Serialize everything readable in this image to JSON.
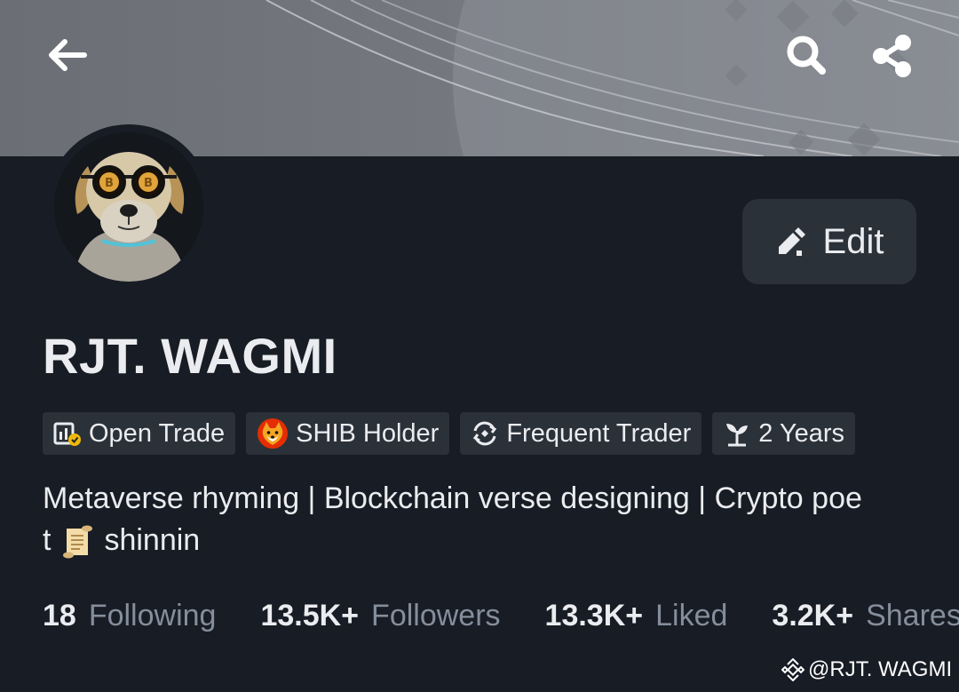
{
  "profile": {
    "name": "RJT. WAGMI",
    "edit_label": "Edit"
  },
  "badges": [
    {
      "label": "Open Trade",
      "icon": "open-trade-icon"
    },
    {
      "label": "SHIB Holder",
      "icon": "shib-token-icon"
    },
    {
      "label": "Frequent Trader",
      "icon": "frequent-trader-icon"
    },
    {
      "label": "2 Years",
      "icon": "sprout-icon"
    }
  ],
  "bio": {
    "line1": "Metaverse rhyming | Blockchain verse designing | Crypto poe",
    "line2_start": "t",
    "line2_emoji": "scroll-emoji",
    "line2_end": "shinnin"
  },
  "stats": [
    {
      "value": "18",
      "label": "Following"
    },
    {
      "value": "13.5K+",
      "label": "Followers"
    },
    {
      "value": "13.3K+",
      "label": "Liked"
    },
    {
      "value": "3.2K+",
      "label": "Shares"
    }
  ],
  "watermark": "@RJT. WAGMI",
  "colors": {
    "background": "#181c24",
    "surface": "#2b3139",
    "text_primary": "#eaecef",
    "text_secondary": "#848e9c",
    "accent": "#f0b90b"
  }
}
